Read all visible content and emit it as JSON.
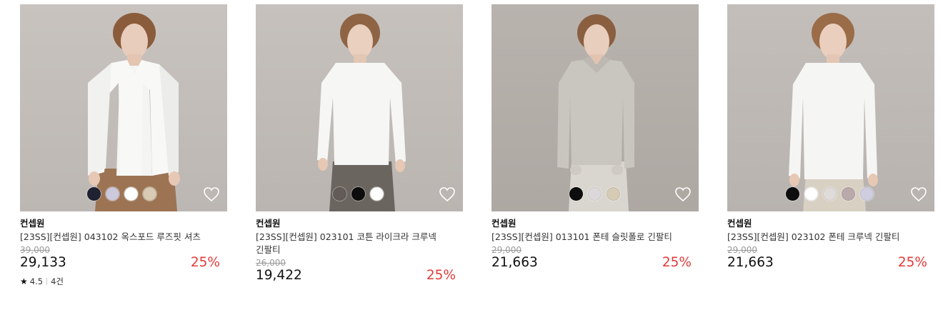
{
  "products": [
    {
      "brand": "컨셉원",
      "title": "[23SS][컨셉원] 043102 옥스포드 루즈핏 셔츠",
      "original_price": "39,000",
      "price": "29,133",
      "discount": "25%",
      "rating": "4.5",
      "review_count": "4건",
      "swatches": [
        "#1e2233",
        "#cdc9dc",
        "#ffffff",
        "#d9cbb3"
      ],
      "heart_icon": "heart-outline-icon"
    },
    {
      "brand": "컨셉원",
      "title": "[23SS][컨셉원] 023101 코튼 라이크라 크루넥 긴팔티",
      "original_price": "26,000",
      "price": "19,422",
      "discount": "25%",
      "swatches": [
        "#625b57",
        "#0d0d0d",
        "#ffffff"
      ],
      "heart_icon": "heart-outline-icon"
    },
    {
      "brand": "컨셉원",
      "title": "[23SS][컨셉원] 013101 폰테 슬릿폴로 긴팔티",
      "original_price": "29,000",
      "price": "21,663",
      "discount": "25%",
      "swatches": [
        "#0d0d0d",
        "#dcd8d9",
        "#d6cbb4"
      ],
      "heart_icon": "heart-outline-icon"
    },
    {
      "brand": "컨셉원",
      "title": "[23SS][컨셉원] 023102 폰테 크루넥 긴팔티",
      "original_price": "29,000",
      "price": "21,663",
      "discount": "25%",
      "swatches": [
        "#0d0d0d",
        "#ffffff",
        "#dedbd9",
        "#b9a9ab",
        "#cfcde0"
      ],
      "heart_icon": "heart-outline-icon"
    }
  ],
  "colors": {
    "discount": "#e23a3a",
    "strike": "#9b9b9b"
  }
}
